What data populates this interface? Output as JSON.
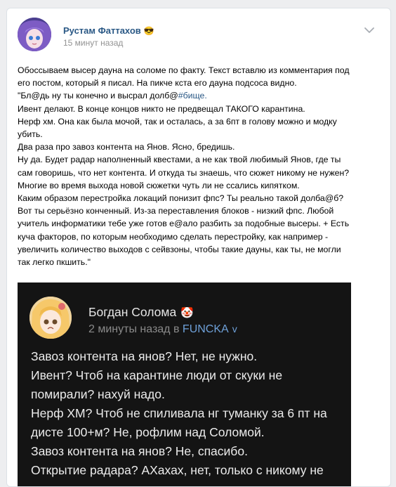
{
  "post": {
    "author": "Рустам Фаттахов",
    "author_emoji": "😎",
    "time": "15 минут назад",
    "menu_icon": "chevron-down-icon",
    "text_lines": [
      "Обоссываем высер дауна на соломе по факту. Текст вставлю из комментария под",
      "его постом, который я писал. На пикче кста его дауна подсоса видно.",
      "\"Бл@дь ну ты конечно и высрал долб@",
      "Ивент делают. В конце концов никто не предвещал ТАКОГО карантина.",
      "Нерф хм. Она как была мочой, так и осталась, а за 6пт в голову можно и модку",
      "убить.",
      "Два раза про завоз контента на Янов. Ясно, бредишь.",
      "Ну да. Будет радар наполненный квестами, а не как твой любимый Янов, где ты",
      "сам говоришь, что нет контента. И откуда ты знаешь, что сюжет никому не нужен?",
      "Многие во время выхода новой сюжетки чуть ли не ссались кипятком.",
      "Каким образом перестройка локаций понизит фпс? Ты реально такой долба@б?",
      "Вот ты серьёзно конченный. Из-за переставления блоков - низкий фпс. Любой",
      "учитель информатики тебе уже готов е@ало разбить за подобные высеры. + Есть",
      "куча факторов, по которым необходимо сделать перестройку, как например -",
      "увеличить количество выходов с сейвзоны, чтобы такие дауны, как ты, не могли",
      "так легко пкшить.\""
    ],
    "hashtag": "#бище."
  },
  "screenshot": {
    "author": "Богдан Солома",
    "author_emoji": "🤡",
    "time": "2 минуты назад в",
    "group": "FUNCKA",
    "group_chevron": "v",
    "text_lines": [
      "Завоз контента на янов? Нет, не нужно.",
      "Ивент? Чтоб на карантине люди от скуки не",
      "помирали? нахуй надо.",
      "Нерф ХМ? Чтоб не спиливала нг туманку за 6 пт на",
      "дисте 100+м? Не, рофлим над Соломой.",
      "Завоз контента на янов? Не, спасибо.",
      "Открытие радара? АХахах, нет, только с никому не"
    ]
  },
  "colors": {
    "page_bg": "#edeef0",
    "link": "#2a5885",
    "meta": "#939393",
    "dark_bg": "#141414",
    "dark_link": "#6ea0d8"
  }
}
